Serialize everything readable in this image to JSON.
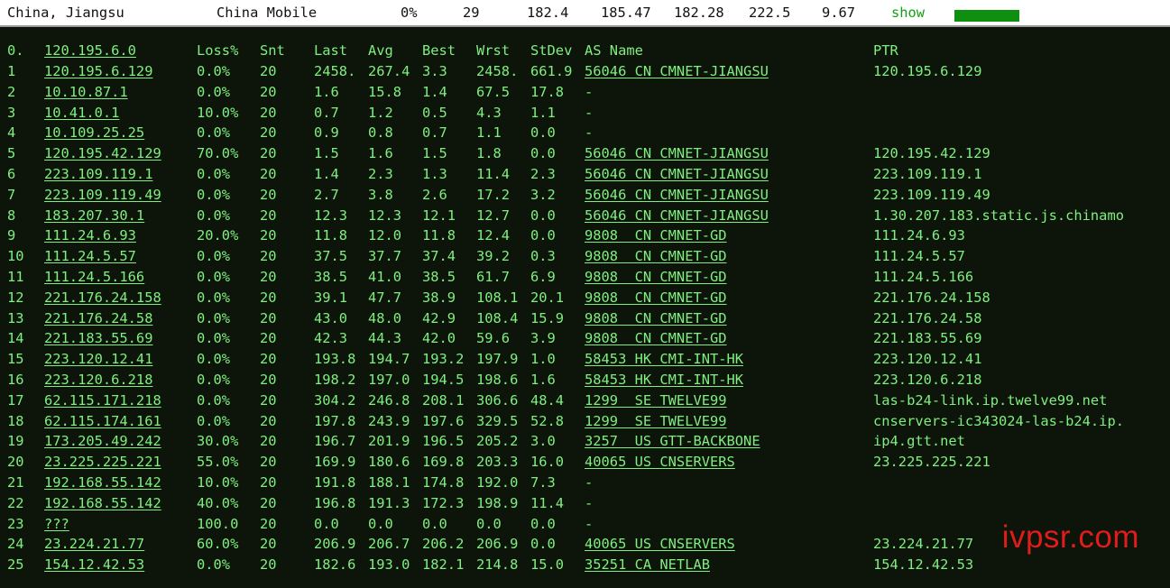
{
  "topbar": {
    "location": "China, Jiangsu",
    "provider": "China Mobile",
    "loss": "0%",
    "snt": "29",
    "last": "182.4",
    "avg": "185.47",
    "best": "182.28",
    "wrst": "222.5",
    "stdev": "9.67",
    "show_label": "show",
    "progress_fraction": 1.0
  },
  "columns": {
    "hop": "0.",
    "host": "120.195.6.0",
    "loss": "Loss%",
    "snt": "Snt",
    "last": "Last",
    "avg": "Avg",
    "best": "Best",
    "wrst": "Wrst",
    "stdev": "StDev",
    "asname": "AS Name",
    "ptr": "PTR"
  },
  "rows": [
    {
      "hop": "1",
      "host": "120.195.6.129",
      "loss": "0.0%",
      "snt": "20",
      "last": "2458.",
      "avg": "267.4",
      "best": "3.3",
      "wrst": "2458.",
      "stdev": "661.9",
      "asname": "56046 CN CMNET-JIANGSU",
      "ptr": "120.195.6.129"
    },
    {
      "hop": "2",
      "host": "10.10.87.1",
      "loss": "0.0%",
      "snt": "20",
      "last": "1.6",
      "avg": "15.8",
      "best": "1.4",
      "wrst": "67.5",
      "stdev": "17.8",
      "asname": "-",
      "ptr": ""
    },
    {
      "hop": "3",
      "host": "10.41.0.1",
      "loss": "10.0%",
      "snt": "20",
      "last": "0.7",
      "avg": "1.2",
      "best": "0.5",
      "wrst": "4.3",
      "stdev": "1.1",
      "asname": "-",
      "ptr": ""
    },
    {
      "hop": "4",
      "host": "10.109.25.25",
      "loss": "0.0%",
      "snt": "20",
      "last": "0.9",
      "avg": "0.8",
      "best": "0.7",
      "wrst": "1.1",
      "stdev": "0.0",
      "asname": "-",
      "ptr": ""
    },
    {
      "hop": "5",
      "host": "120.195.42.129",
      "loss": "70.0%",
      "snt": "20",
      "last": "1.5",
      "avg": "1.6",
      "best": "1.5",
      "wrst": "1.8",
      "stdev": "0.0",
      "asname": "56046 CN CMNET-JIANGSU",
      "ptr": "120.195.42.129"
    },
    {
      "hop": "6",
      "host": "223.109.119.1",
      "loss": "0.0%",
      "snt": "20",
      "last": "1.4",
      "avg": "2.3",
      "best": "1.3",
      "wrst": "11.4",
      "stdev": "2.3",
      "asname": "56046 CN CMNET-JIANGSU",
      "ptr": "223.109.119.1"
    },
    {
      "hop": "7",
      "host": "223.109.119.49",
      "loss": "0.0%",
      "snt": "20",
      "last": "2.7",
      "avg": "3.8",
      "best": "2.6",
      "wrst": "17.2",
      "stdev": "3.2",
      "asname": "56046 CN CMNET-JIANGSU",
      "ptr": "223.109.119.49"
    },
    {
      "hop": "8",
      "host": "183.207.30.1",
      "loss": "0.0%",
      "snt": "20",
      "last": "12.3",
      "avg": "12.3",
      "best": "12.1",
      "wrst": "12.7",
      "stdev": "0.0",
      "asname": "56046 CN CMNET-JIANGSU",
      "ptr": "1.30.207.183.static.js.chinamo"
    },
    {
      "hop": "9",
      "host": "111.24.6.93",
      "loss": "20.0%",
      "snt": "20",
      "last": "11.8",
      "avg": "12.0",
      "best": "11.8",
      "wrst": "12.4",
      "stdev": "0.0",
      "asname": "9808  CN CMNET-GD",
      "ptr": "111.24.6.93"
    },
    {
      "hop": "10",
      "host": "111.24.5.57",
      "loss": "0.0%",
      "snt": "20",
      "last": "37.5",
      "avg": "37.7",
      "best": "37.4",
      "wrst": "39.2",
      "stdev": "0.3",
      "asname": "9808  CN CMNET-GD",
      "ptr": "111.24.5.57"
    },
    {
      "hop": "11",
      "host": "111.24.5.166",
      "loss": "0.0%",
      "snt": "20",
      "last": "38.5",
      "avg": "41.0",
      "best": "38.5",
      "wrst": "61.7",
      "stdev": "6.9",
      "asname": "9808  CN CMNET-GD",
      "ptr": "111.24.5.166"
    },
    {
      "hop": "12",
      "host": "221.176.24.158",
      "loss": "0.0%",
      "snt": "20",
      "last": "39.1",
      "avg": "47.7",
      "best": "38.9",
      "wrst": "108.1",
      "stdev": "20.1",
      "asname": "9808  CN CMNET-GD",
      "ptr": "221.176.24.158"
    },
    {
      "hop": "13",
      "host": "221.176.24.58",
      "loss": "0.0%",
      "snt": "20",
      "last": "43.0",
      "avg": "48.0",
      "best": "42.9",
      "wrst": "108.4",
      "stdev": "15.9",
      "asname": "9808  CN CMNET-GD",
      "ptr": "221.176.24.58"
    },
    {
      "hop": "14",
      "host": "221.183.55.69",
      "loss": "0.0%",
      "snt": "20",
      "last": "42.3",
      "avg": "44.3",
      "best": "42.0",
      "wrst": "59.6",
      "stdev": "3.9",
      "asname": "9808  CN CMNET-GD",
      "ptr": "221.183.55.69"
    },
    {
      "hop": "15",
      "host": "223.120.12.41",
      "loss": "0.0%",
      "snt": "20",
      "last": "193.8",
      "avg": "194.7",
      "best": "193.2",
      "wrst": "197.9",
      "stdev": "1.0",
      "asname": "58453 HK CMI-INT-HK",
      "ptr": "223.120.12.41"
    },
    {
      "hop": "16",
      "host": "223.120.6.218",
      "loss": "0.0%",
      "snt": "20",
      "last": "198.2",
      "avg": "197.0",
      "best": "194.5",
      "wrst": "198.6",
      "stdev": "1.6",
      "asname": "58453 HK CMI-INT-HK",
      "ptr": "223.120.6.218"
    },
    {
      "hop": "17",
      "host": "62.115.171.218",
      "loss": "0.0%",
      "snt": "20",
      "last": "304.2",
      "avg": "246.8",
      "best": "208.1",
      "wrst": "306.6",
      "stdev": "48.4",
      "asname": "1299  SE TWELVE99",
      "ptr": "las-b24-link.ip.twelve99.net"
    },
    {
      "hop": "18",
      "host": "62.115.174.161",
      "loss": "0.0%",
      "snt": "20",
      "last": "197.8",
      "avg": "243.9",
      "best": "197.6",
      "wrst": "329.5",
      "stdev": "52.8",
      "asname": "1299  SE TWELVE99",
      "ptr": "cnservers-ic343024-las-b24.ip."
    },
    {
      "hop": "19",
      "host": "173.205.49.242",
      "loss": "30.0%",
      "snt": "20",
      "last": "196.7",
      "avg": "201.9",
      "best": "196.5",
      "wrst": "205.2",
      "stdev": "3.0",
      "asname": "3257  US GTT-BACKBONE",
      "ptr": "ip4.gtt.net"
    },
    {
      "hop": "20",
      "host": "23.225.225.221",
      "loss": "55.0%",
      "snt": "20",
      "last": "169.9",
      "avg": "180.6",
      "best": "169.8",
      "wrst": "203.3",
      "stdev": "16.0",
      "asname": "40065 US CNSERVERS",
      "ptr": "23.225.225.221"
    },
    {
      "hop": "21",
      "host": "192.168.55.142",
      "loss": "10.0%",
      "snt": "20",
      "last": "191.8",
      "avg": "188.1",
      "best": "174.8",
      "wrst": "192.0",
      "stdev": "7.3",
      "asname": "-",
      "ptr": ""
    },
    {
      "hop": "22",
      "host": "192.168.55.142",
      "loss": "40.0%",
      "snt": "20",
      "last": "196.8",
      "avg": "191.3",
      "best": "172.3",
      "wrst": "198.9",
      "stdev": "11.4",
      "asname": "-",
      "ptr": ""
    },
    {
      "hop": "23",
      "host": "???",
      "loss": "100.0",
      "snt": "20",
      "last": "0.0",
      "avg": "0.0",
      "best": "0.0",
      "wrst": "0.0",
      "stdev": "0.0",
      "asname": "-",
      "ptr": ""
    },
    {
      "hop": "24",
      "host": "23.224.21.77",
      "loss": "60.0%",
      "snt": "20",
      "last": "206.9",
      "avg": "206.7",
      "best": "206.2",
      "wrst": "206.9",
      "stdev": "0.0",
      "asname": "40065 US CNSERVERS",
      "ptr": "23.224.21.77"
    },
    {
      "hop": "25",
      "host": "154.12.42.53",
      "loss": "0.0%",
      "snt": "20",
      "last": "182.6",
      "avg": "193.0",
      "best": "182.1",
      "wrst": "214.8",
      "stdev": "15.0",
      "asname": "35251 CA NETLAB",
      "ptr": "154.12.42.53"
    }
  ],
  "watermark": "ivpsr.com",
  "colors": {
    "background": "#0d1409",
    "text": "#7ff07f",
    "progress": "#0f8f0f",
    "watermark": "#e21b1b"
  }
}
